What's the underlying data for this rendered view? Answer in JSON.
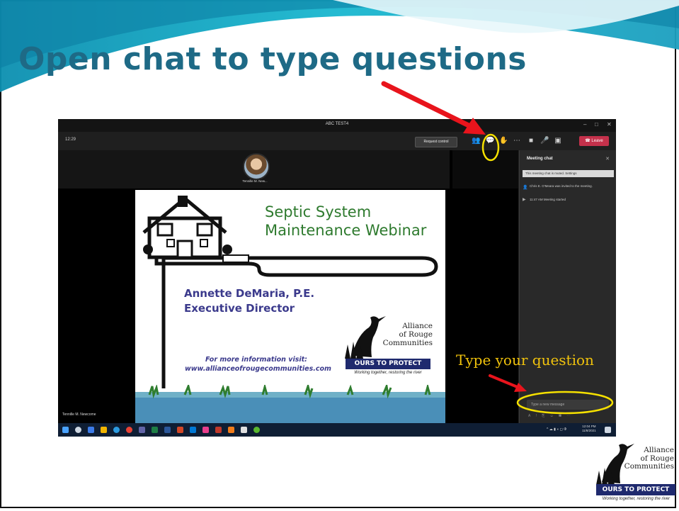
{
  "slide": {
    "title": "Open chat to type questions",
    "annotation_type_question": "Type your question"
  },
  "teams": {
    "window_title": "ABC TEST4",
    "clock": "12:29",
    "request_control": "Request control",
    "leave": "Leave",
    "participant_name": "Tennille M. New...",
    "self_name": "Tennille M. Newcome",
    "chat": {
      "heading": "Meeting chat",
      "muted_notice": "This meeting chat is muted. Settings",
      "events": [
        "Chris E. O'Meara was invited to the meeting.",
        "11:47 AM  Meeting started"
      ],
      "input_placeholder": "Type a new message"
    },
    "tray_time": "12:04 PM",
    "tray_date": "11/8/2021"
  },
  "shared_slide": {
    "title_line1": "Septic System",
    "title_line2": "Maintenance Webinar",
    "presenter_name": "Annette DeMaria, P.E.",
    "presenter_role": "Executive Director",
    "info_line1": "For more information visit:",
    "info_line2": "www.allianceofrougecommunities.com"
  },
  "logo": {
    "line1": "Alliance",
    "line2": "of Rouge",
    "line3": "Communities",
    "badge": "OURS TO PROTECT",
    "tagline": "Working together, restoring the river"
  },
  "colors": {
    "title": "#1e6a86",
    "arrow": "#e8141c",
    "highlight": "#f5e000",
    "leave": "#c4314b",
    "badge": "#1f2a6e"
  }
}
